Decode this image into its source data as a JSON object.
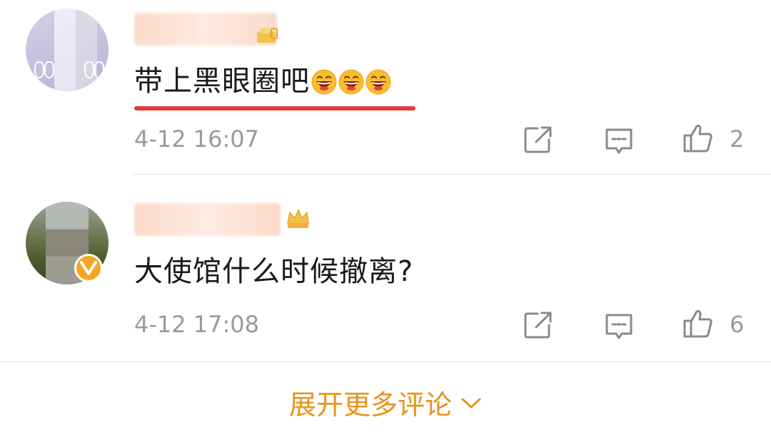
{
  "comments": [
    {
      "text": "带上黑眼圈吧",
      "emoji_name": "grinning-face-emoji",
      "emoji_count": 3,
      "time": "4-12 16:07",
      "like_count": "2",
      "verified": false
    },
    {
      "text": "大使馆什么时候撤离?",
      "time": "4-12 17:08",
      "like_count": "6",
      "verified": true
    }
  ],
  "icons": {
    "share": "share-icon",
    "comment": "comment-icon",
    "like": "thumbs-up-icon",
    "expand": "chevron-down-icon",
    "verified": "verified-v-icon"
  },
  "colors": {
    "accent": "#e8941a",
    "underline": "#e23b3b",
    "meta_text": "#9a9a9a",
    "verified_badge": "#f5a623"
  },
  "footer": {
    "more_comments_label": "展开更多评论"
  }
}
